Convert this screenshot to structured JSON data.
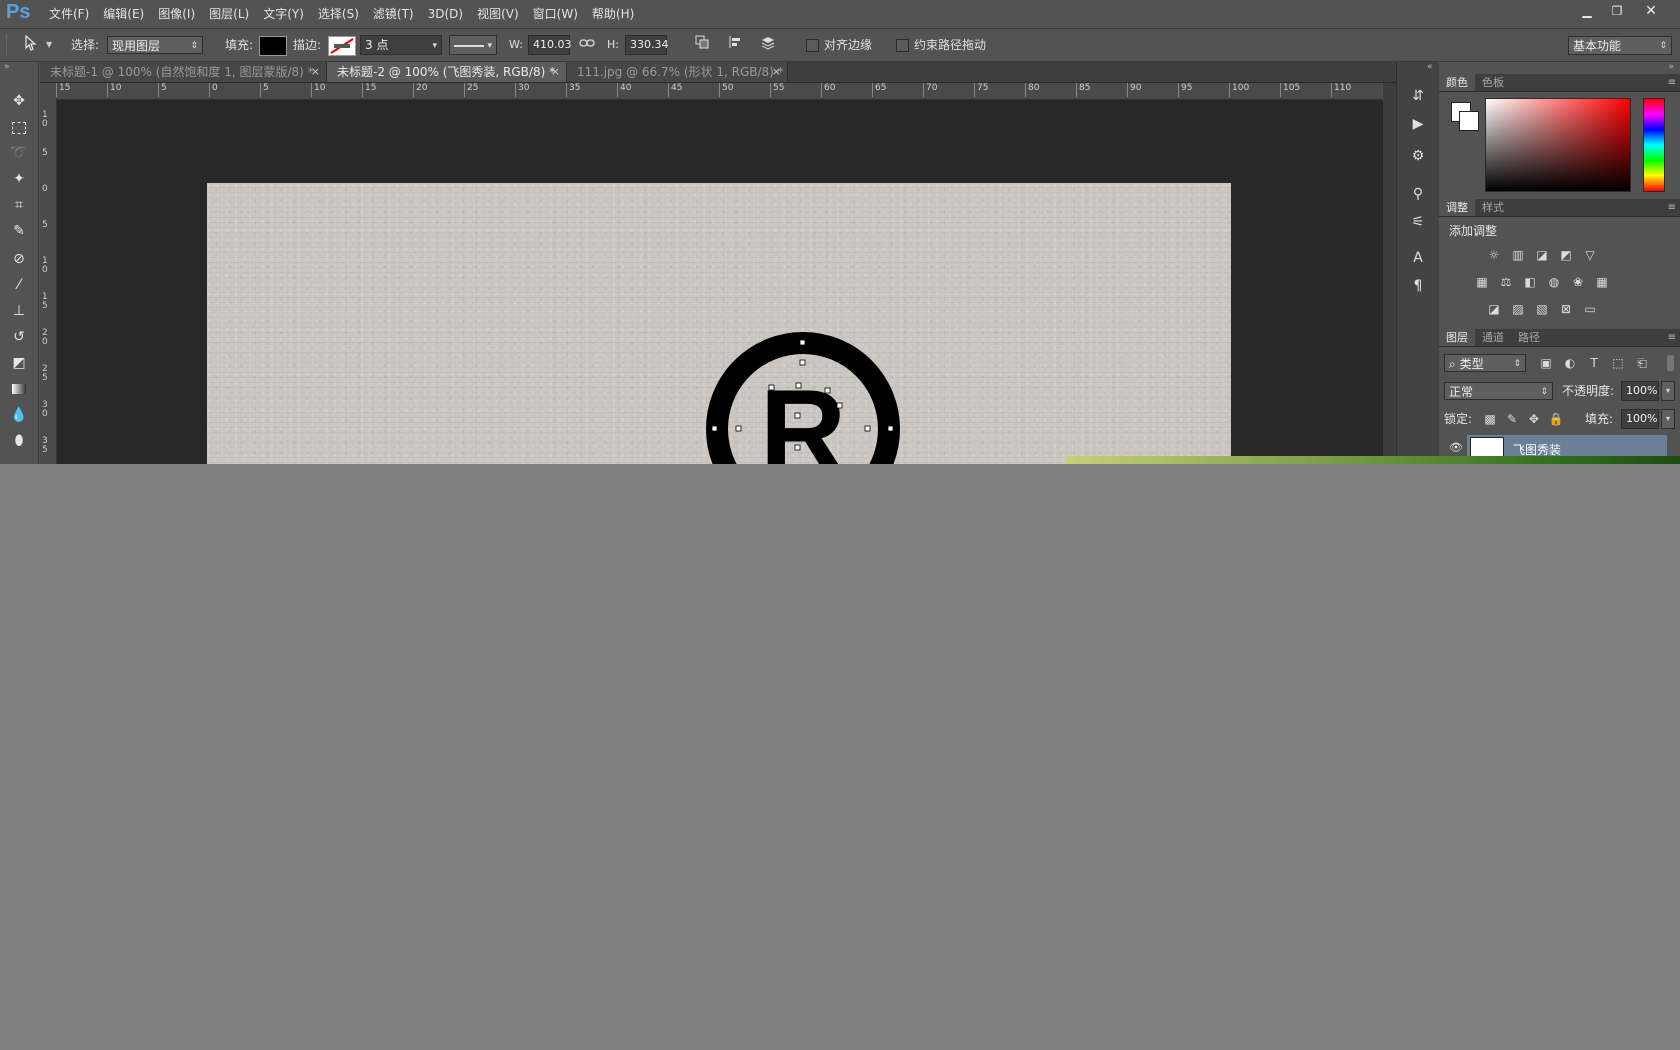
{
  "app": {
    "logo": "Ps"
  },
  "menu": [
    "文件(F)",
    "编辑(E)",
    "图像(I)",
    "图层(L)",
    "文字(Y)",
    "选择(S)",
    "滤镜(T)",
    "3D(D)",
    "视图(V)",
    "窗口(W)",
    "帮助(H)"
  ],
  "window_controls": {
    "minimize": "▁",
    "maximize": "❐",
    "close": "✕"
  },
  "options": {
    "select_label": "选择:",
    "select_value": "现用图层",
    "fill_label": "填充:",
    "stroke_label": "描边:",
    "stroke_width": "3 点",
    "w_label": "W:",
    "w_value": "410.03",
    "h_label": "H:",
    "h_value": "330.34",
    "align_edges": "对齐边缘",
    "constrain_path": "约束路径拖动",
    "workspace": "基本功能"
  },
  "tabs": [
    {
      "label": "未标题-1 @ 100% (自然饱和度 1, 图层蒙版/8) *",
      "active": false
    },
    {
      "label": "未标题-2 @ 100% (飞图秀装, RGB/8) *",
      "active": true
    },
    {
      "label": "111.jpg @ 66.7% (形状 1, RGB/8) *",
      "active": false
    }
  ],
  "ruler_h": [
    "15",
    "10",
    "5",
    "0",
    "5",
    "10",
    "15",
    "20",
    "25",
    "30",
    "35",
    "40",
    "45",
    "50",
    "55",
    "60",
    "65",
    "70",
    "75",
    "80",
    "85",
    "90",
    "95",
    "100",
    "105",
    "110"
  ],
  "ruler_v": [
    "1 0",
    "5",
    "0",
    "5",
    "1 0",
    "1 5",
    "2 0",
    "2 5",
    "3 0",
    "3 5"
  ],
  "canvas": {
    "logo_letter": "R"
  },
  "panels": {
    "color_tabs": [
      "颜色",
      "色板"
    ],
    "adjust_tabs": [
      "调整",
      "样式"
    ],
    "adjust_title": "添加调整",
    "layers_tabs": [
      "图层",
      "通道",
      "路径"
    ],
    "filter_kind": "类型",
    "blend_mode": "正常",
    "opacity_label": "不透明度:",
    "opacity_value": "100%",
    "lock_label": "锁定:",
    "fill_label": "填充:",
    "fill_value": "100%",
    "layer_name": "飞图秀装"
  },
  "colors": {
    "menubar": "#535353",
    "canvas_bg": "#282828",
    "paper": "#cbc6c0",
    "ps_blue": "#5aa0e6",
    "layer_selected": "#6b7f96"
  }
}
